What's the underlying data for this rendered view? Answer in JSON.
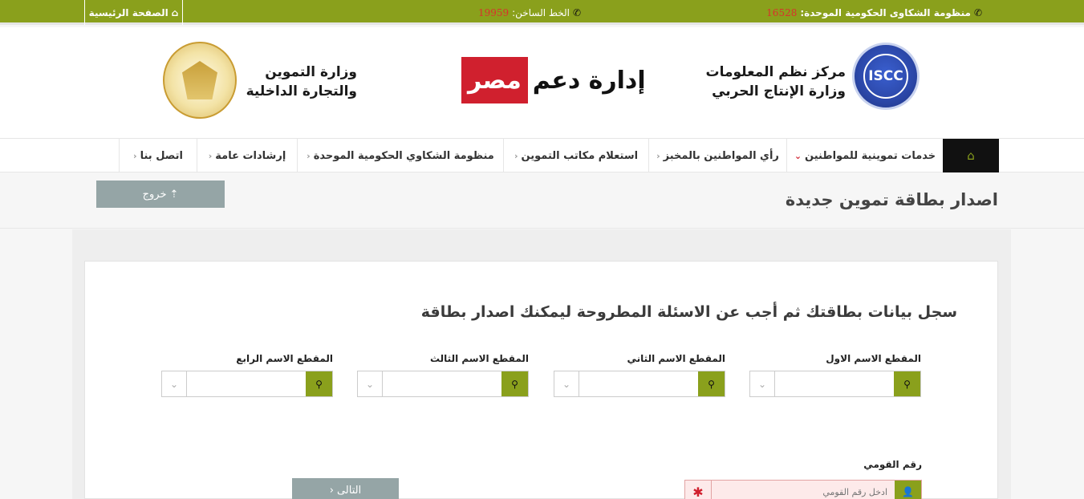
{
  "topbar": {
    "home_label": "الصفحة الرئيسية",
    "hotline_label": "الخط الساخن:",
    "hotline_number": "19959",
    "complaints_label": "منظومة الشكاوى الحكومية الموحدة:",
    "complaints_number": "16528"
  },
  "header": {
    "iscc_logo_text": "ISCC",
    "iscc_line1": "مركز نظم المعلومات",
    "iscc_line2": "وزارة الإنتاج الحربي",
    "brand_part1": "إدارة دعم",
    "brand_part2": "مصر",
    "ministry_line1": "وزارة التموين",
    "ministry_line2": "والتجارة الداخلية"
  },
  "nav": {
    "items": [
      {
        "label": "خدمات تموينية للمواطنين"
      },
      {
        "label": "رأي المواطنين بالمخبز"
      },
      {
        "label": "استعلام مكاتب التموين"
      },
      {
        "label": "منظومة الشكاوي الحكومية الموحدة"
      },
      {
        "label": "إرشادات عامة"
      },
      {
        "label": "اتصل بنا"
      }
    ]
  },
  "page": {
    "title": "اصدار بطاقة تموين جديدة",
    "logout_label": "خروج"
  },
  "form": {
    "heading": "سجل بيانات بطاقتك ثم أجب عن الاسئلة المطروحة ليمكنك اصدار بطاقة",
    "name_fields": [
      {
        "label": "المقطع الاسم الاول"
      },
      {
        "label": "المقطع الاسم الثاني"
      },
      {
        "label": "المقطع الاسم الثالث"
      },
      {
        "label": "المقطع الاسم الرابع"
      }
    ],
    "national_id_label": "رقم القومي",
    "national_id_placeholder": "ادخل رقم القومي",
    "next_label": "التالى"
  },
  "colors": {
    "accent": "#8aa01c",
    "brand_red": "#d0202e",
    "button_gray": "#95a5a6"
  }
}
